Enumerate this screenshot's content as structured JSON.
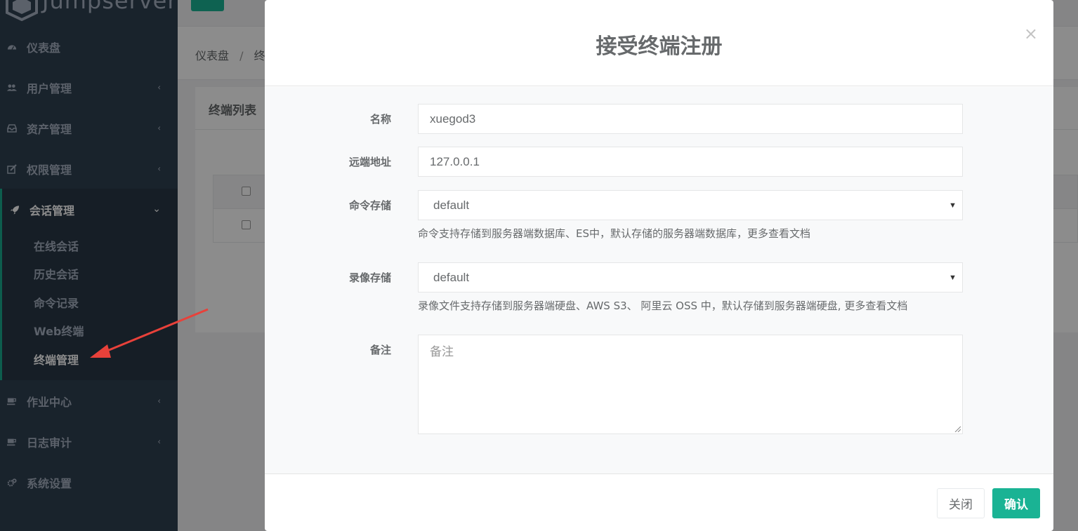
{
  "app": {
    "logo_text": "Jumpserver"
  },
  "sidebar": {
    "items": [
      {
        "label": "仪表盘",
        "icon": "dashboard-icon"
      },
      {
        "label": "用户管理",
        "icon": "users-icon"
      },
      {
        "label": "资产管理",
        "icon": "inbox-icon"
      },
      {
        "label": "权限管理",
        "icon": "edit-icon"
      },
      {
        "label": "会话管理",
        "icon": "rocket-icon"
      },
      {
        "label": "作业中心",
        "icon": "coffee-icon"
      },
      {
        "label": "日志审计",
        "icon": "coffee-icon"
      },
      {
        "label": "系统设置",
        "icon": "gears-icon"
      }
    ],
    "sub_items": [
      {
        "label": "在线会话"
      },
      {
        "label": "历史会话"
      },
      {
        "label": "命令记录"
      },
      {
        "label": "Web终端"
      },
      {
        "label": "终端管理"
      }
    ],
    "chevron_left": "‹",
    "chevron_down": "⌄"
  },
  "breadcrumb": {
    "home": "仪表盘",
    "separator": "/",
    "current": "终"
  },
  "panel": {
    "title": "终端列表"
  },
  "modal": {
    "title": "接受终端注册",
    "close": "×",
    "fields": {
      "name": {
        "label": "名称",
        "value": "xuegod3"
      },
      "remote_addr": {
        "label": "远端地址",
        "value": "127.0.0.1"
      },
      "command_storage": {
        "label": "命令存储",
        "value": "default",
        "help": "命令支持存储到服务器端数据库、ES中，默认存储的服务器端数据库，更多查看文档"
      },
      "replay_storage": {
        "label": "录像存储",
        "value": "default",
        "help": "录像文件支持存储到服务器端硬盘、AWS S3、 阿里云 OSS 中，默认存储到服务器端硬盘, 更多查看文档"
      },
      "comment": {
        "label": "备注",
        "placeholder": "备注"
      }
    },
    "buttons": {
      "close": "关闭",
      "confirm": "确认"
    }
  },
  "colors": {
    "accent": "#1ab394",
    "sidebar": "#2f4050",
    "arrow": "#e8413a"
  }
}
